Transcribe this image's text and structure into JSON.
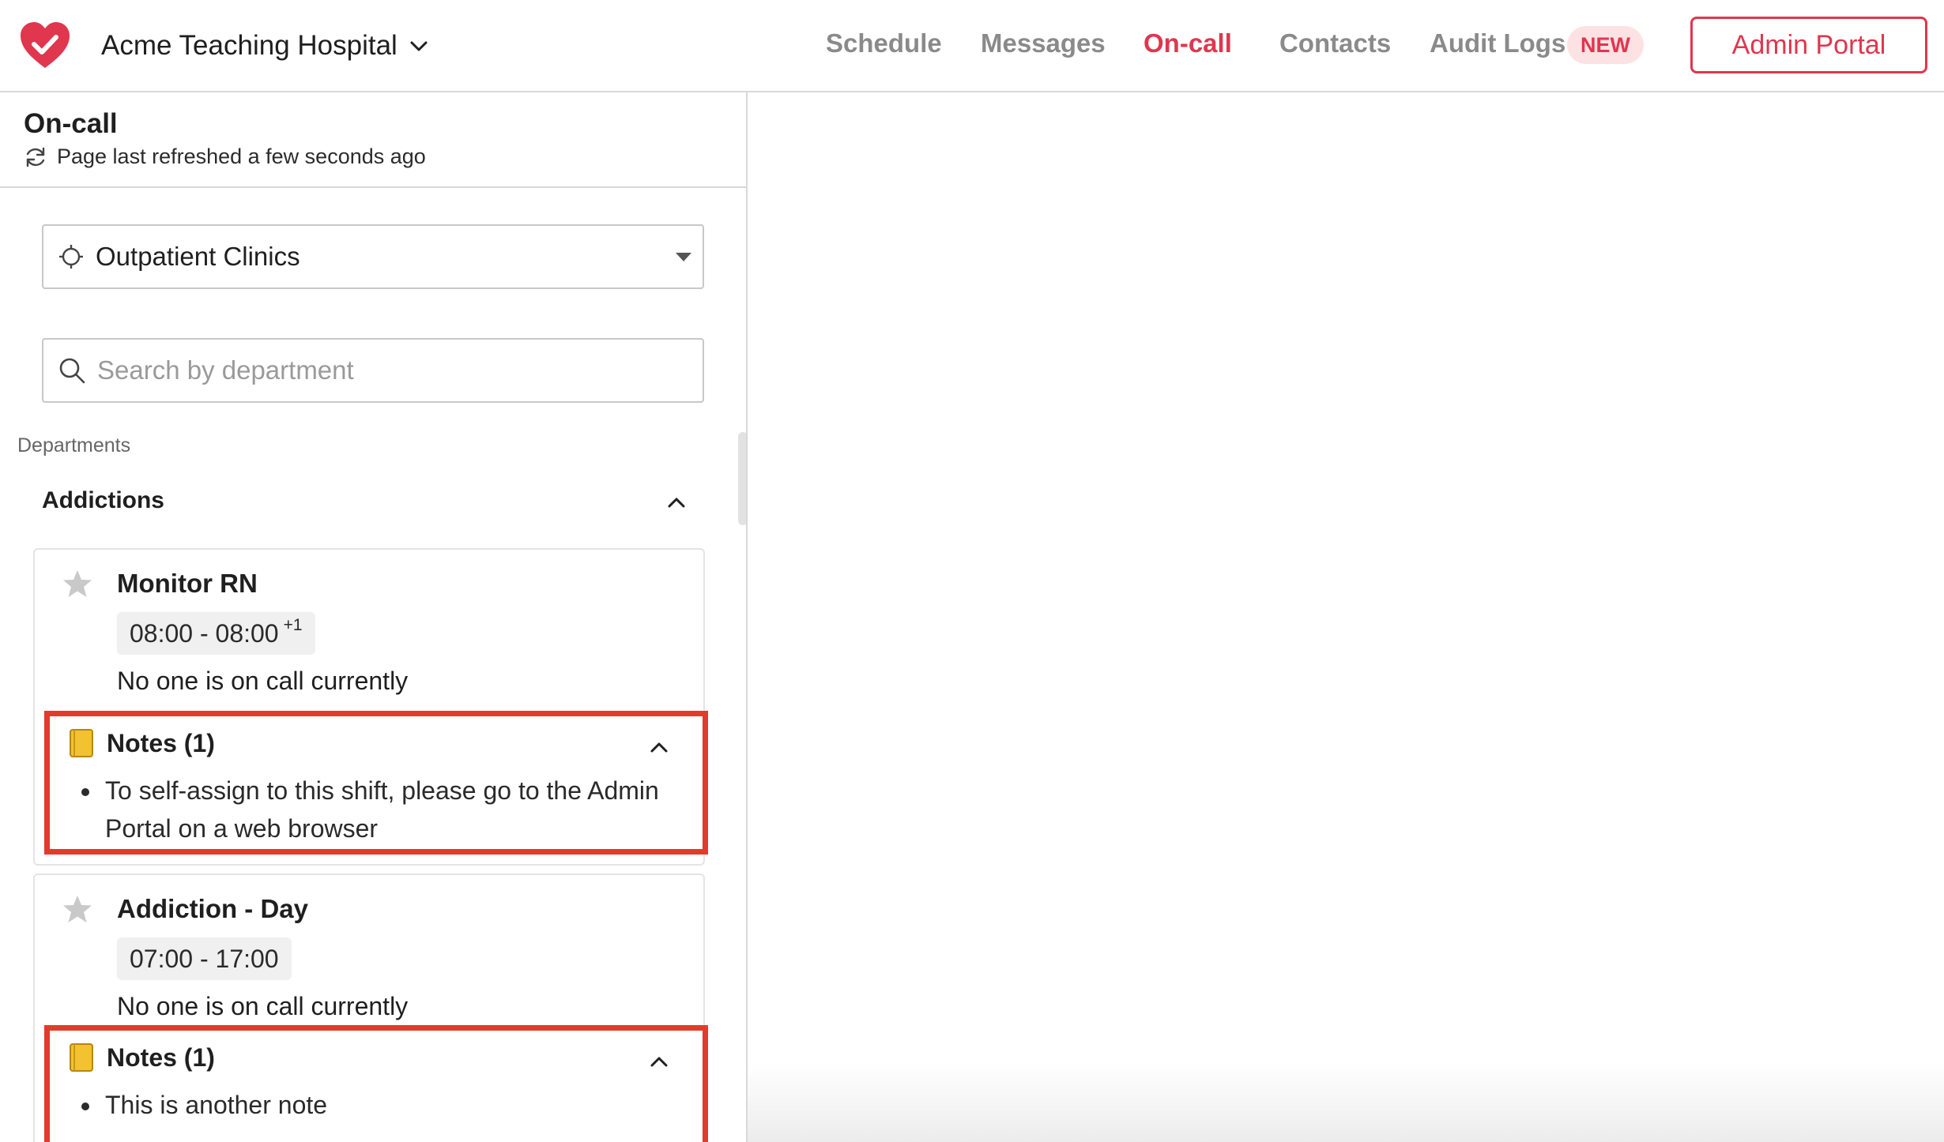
{
  "app": {
    "org_name": "Acme Teaching Hospital",
    "logo_icon": "heart-check-icon",
    "brand_color": "#e0364e"
  },
  "nav": {
    "links": [
      {
        "label": "Schedule"
      },
      {
        "label": "Messages"
      },
      {
        "label": "On-call",
        "active": true
      },
      {
        "label": "Contacts"
      },
      {
        "label": "Audit Logs"
      }
    ],
    "new_badge": "NEW",
    "admin_button": "Admin Portal"
  },
  "page": {
    "title": "On-call",
    "refresh_text": "Page last refreshed a few seconds ago"
  },
  "filters": {
    "location": "Outpatient Clinics",
    "search_placeholder": "Search by department"
  },
  "departments": {
    "label": "Departments",
    "items": [
      {
        "name": "Addictions",
        "expanded": true,
        "shifts": [
          {
            "name": "Monitor RN",
            "time": "08:00 - 08:00",
            "time_suffix": "+1",
            "status": "No one is on call currently",
            "notes_title": "Notes (1)",
            "notes": [
              "To self-assign to this shift, please go to the Admin Portal on a web browser"
            ]
          },
          {
            "name": "Addiction - Day",
            "time": "07:00 - 17:00",
            "time_suffix": "",
            "status": "No one is on call currently",
            "notes_title": "Notes (1)",
            "notes": [
              "This is another note"
            ]
          }
        ]
      }
    ]
  },
  "highlight_color": "#e23b2b"
}
